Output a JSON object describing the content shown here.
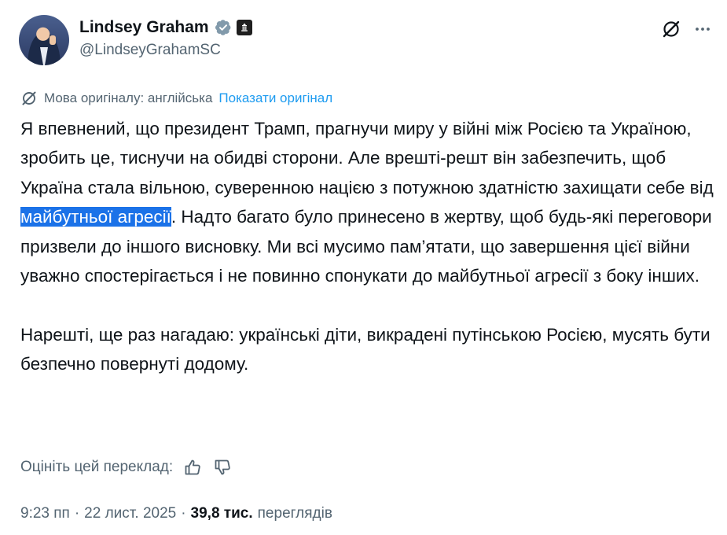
{
  "author": {
    "name": "Lindsey Graham",
    "handle": "@LindseyGrahamSC",
    "verified_color": "#829aab"
  },
  "header_icons": [
    "grok-icon",
    "more-icon"
  ],
  "translation": {
    "notice": "Мова оригіналу: англійська",
    "show_original": "Показати оригінал"
  },
  "tweet": {
    "p1_before": "Я впевнений, що президент Трамп, прагнучи миру у війні між Росією та Україною, зробить це, тиснучи на обидві сторони. Але врешті-решт він забезпечить, щоб Україна стала вільною, суверенною нацією з потужною здатністю захищати себе від ",
    "p1_highlight": "майбутньої агресії",
    "p1_after": ". Надто багато було принесено в жертву, щоб будь-які переговори призвели до іншого висновку. Ми всі мусимо пам’ятати, що завершення цієї війни уважно спостерігається і не повинно спонукати до майбутньої агресії з боку інших.",
    "p2": "Нарешті, ще раз нагадаю: українські діти, викрадені путінською Росією, мусять бути безпечно повернуті додому."
  },
  "rate": {
    "label": "Оцініть цей переклад:"
  },
  "meta": {
    "time": "9:23 пп",
    "separator": "·",
    "date": "22 лист. 2025",
    "views": "39,8 тис.",
    "views_label": "переглядів"
  },
  "colors": {
    "text": "#0f1419",
    "secondary": "#536471",
    "link": "#1d9bf0",
    "highlight": "#1b72e8"
  }
}
